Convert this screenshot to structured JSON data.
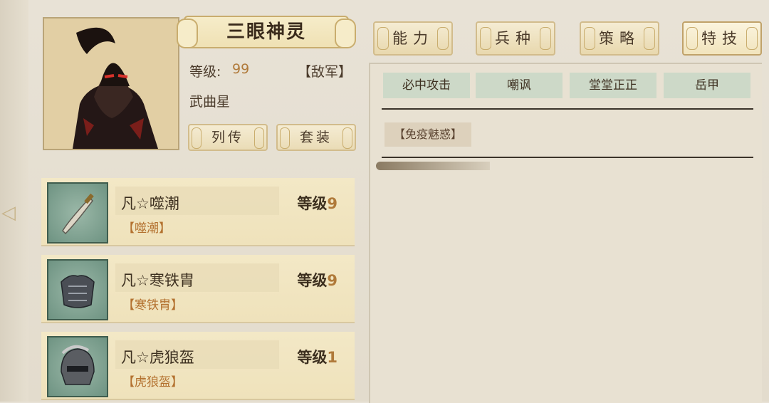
{
  "hero": {
    "name": "三眼神灵",
    "level_label": "等级:",
    "level_value": "99",
    "faction": "【敌军】",
    "star": "武曲星"
  },
  "buttons": {
    "bio": "列传",
    "set": "套装"
  },
  "tabs": [
    {
      "label": "能力"
    },
    {
      "label": "兵种"
    },
    {
      "label": "策略"
    },
    {
      "label": "特技"
    }
  ],
  "skills": [
    "必中攻击",
    "嘲讽",
    "堂堂正正",
    "岳甲"
  ],
  "immunity": "【免疫魅惑】",
  "equipment": [
    {
      "name": "凡☆噬潮",
      "level_label": "等级",
      "level": "9",
      "sub": "【噬潮】",
      "icon": "weapon-icon"
    },
    {
      "name": "凡☆寒铁胄",
      "level_label": "等级",
      "level": "9",
      "sub": "【寒铁胄】",
      "icon": "armor-icon"
    },
    {
      "name": "凡☆虎狼盔",
      "level_label": "等级",
      "level": "1",
      "sub": "【虎狼盔】",
      "icon": "helmet-icon"
    }
  ]
}
